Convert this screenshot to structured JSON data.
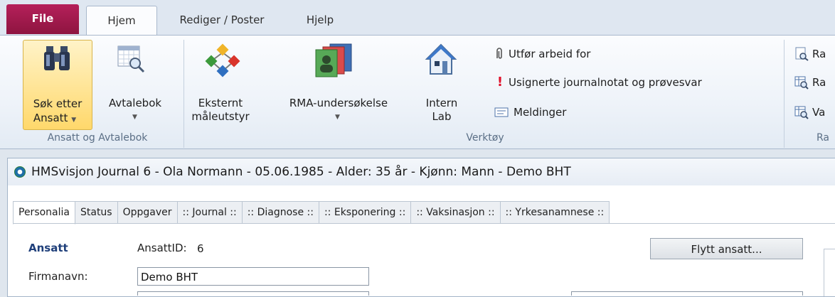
{
  "ribbon": {
    "tabs": [
      {
        "label": "File"
      },
      {
        "label": "Hjem"
      },
      {
        "label": "Rediger / Poster"
      },
      {
        "label": "Hjelp"
      }
    ],
    "groups": {
      "ansatt": {
        "label": "Ansatt og Avtalebok",
        "sok_line1": "Søk etter",
        "sok_line2": "Ansatt",
        "avtalebok": "Avtalebok"
      },
      "verktoy": {
        "label": "Verktøy",
        "eksternt_line1": "Eksternt",
        "eksternt_line2": "måleutstyr",
        "rma": "RMA-undersøkelse",
        "intern_line1": "Intern",
        "intern_line2": "Lab",
        "utfor": "Utfør arbeid for",
        "usignerte": "Usignerte journalnotat og prøvesvar",
        "meldinger": "Meldinger"
      },
      "rapporter": {
        "label": "Ra",
        "item1": "Ra",
        "item2": "Ra",
        "item3": "Va"
      }
    }
  },
  "document": {
    "title": "HMSvisjon Journal  6  -  Ola Normann  -  05.06.1985  -  Alder: 35 år  -  Kjønn: Mann  -  Demo BHT",
    "tabs": [
      "Personalia",
      "Status",
      "Oppgaver",
      ":: Journal ::",
      ":: Diagnose ::",
      ":: Eksponering ::",
      ":: Vaksinasjon ::",
      ":: Yrkesanamnese ::"
    ],
    "form": {
      "section_title": "Ansatt",
      "ansattid_label": "AnsattID:",
      "ansattid_value": "6",
      "firmanavn_label": "Firmanavn:",
      "firmanavn_value": "Demo BHT",
      "flytt_button": "Flytt ansatt..."
    }
  },
  "colors": {
    "file_tab": "#a8194d",
    "section_title": "#1f3f7a",
    "ribbon_bg": "#eef3f9"
  }
}
